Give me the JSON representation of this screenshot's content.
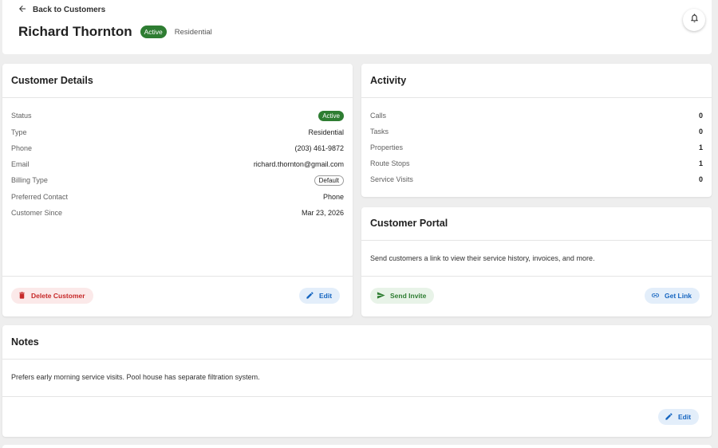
{
  "header": {
    "back_label": "Back to Customers",
    "customer_name": "Richard Thornton",
    "status_badge": "Active",
    "customer_type": "Residential",
    "notification_icon": "bell-icon"
  },
  "details": {
    "title": "Customer Details",
    "rows": [
      {
        "label": "Status",
        "value": "Active"
      },
      {
        "label": "Type",
        "value": "Residential"
      },
      {
        "label": "Phone",
        "value": "(203) 461-9872"
      },
      {
        "label": "Email",
        "value": "richard.thornton@gmail.com"
      },
      {
        "label": "Billing Type",
        "value": "Default"
      },
      {
        "label": "Preferred Contact",
        "value": "Phone"
      },
      {
        "label": "Customer Since",
        "value": "Mar 23, 2026"
      }
    ],
    "delete_label": "Delete Customer",
    "edit_label": "Edit"
  },
  "activity": {
    "title": "Activity",
    "rows": [
      {
        "label": "Calls",
        "value": "0"
      },
      {
        "label": "Tasks",
        "value": "0"
      },
      {
        "label": "Properties",
        "value": "1"
      },
      {
        "label": "Route Stops",
        "value": "1"
      },
      {
        "label": "Service Visits",
        "value": "0"
      }
    ]
  },
  "portal": {
    "title": "Customer Portal",
    "description": "Send customers a link to view their service history, invoices, and more.",
    "send_invite_label": "Send Invite",
    "get_link_label": "Get Link"
  },
  "notes": {
    "title": "Notes",
    "text": "Prefers early morning service visits. Pool house has separate filtration system.",
    "edit_label": "Edit"
  },
  "colors": {
    "active_green": "#2e7d32",
    "danger_red": "#c62828",
    "primary_blue": "#1565c0"
  }
}
